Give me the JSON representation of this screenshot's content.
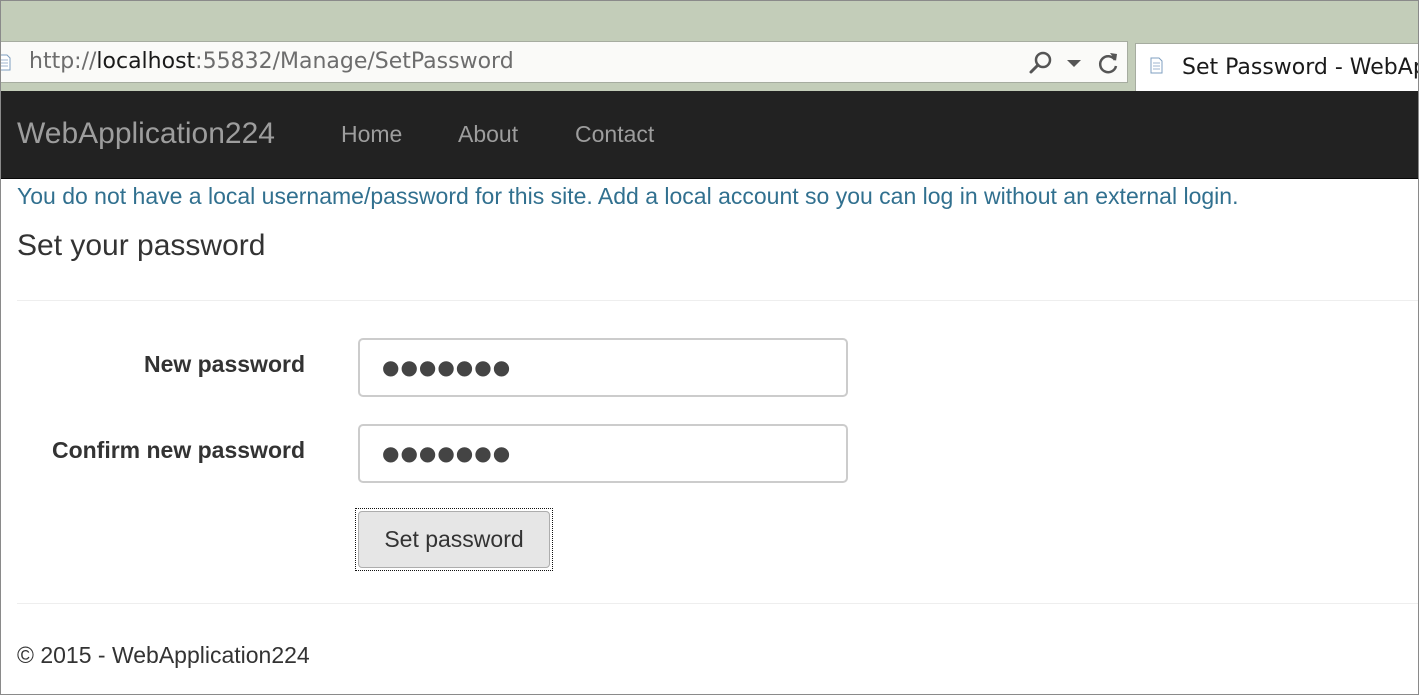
{
  "browser": {
    "url_scheme": "http://",
    "url_host": "localhost",
    "url_path": ":55832/Manage/SetPassword",
    "tab_title": "Set Password - WebApp",
    "icons": [
      "page-icon",
      "search-icon",
      "dropdown-arrow-icon",
      "refresh-icon"
    ]
  },
  "navbar": {
    "brand": "WebApplication224",
    "links": [
      "Home",
      "About",
      "Contact"
    ]
  },
  "main": {
    "info": "You do not have a local username/password for this site. Add a local account so you can log in without an external login.",
    "title": "Set your password",
    "form": {
      "new_password_label": "New password",
      "new_password_mask": "●●●●●●●",
      "confirm_password_label": "Confirm new password",
      "confirm_password_mask": "●●●●●●●",
      "submit_label": "Set password"
    }
  },
  "footer": {
    "text": "© 2015 - WebApplication224"
  },
  "colors": {
    "chrome": "#c3cdb9",
    "navbar": "#222222",
    "nav_text": "#9d9d9d",
    "info_text": "#31708f",
    "body_text": "#333333"
  }
}
